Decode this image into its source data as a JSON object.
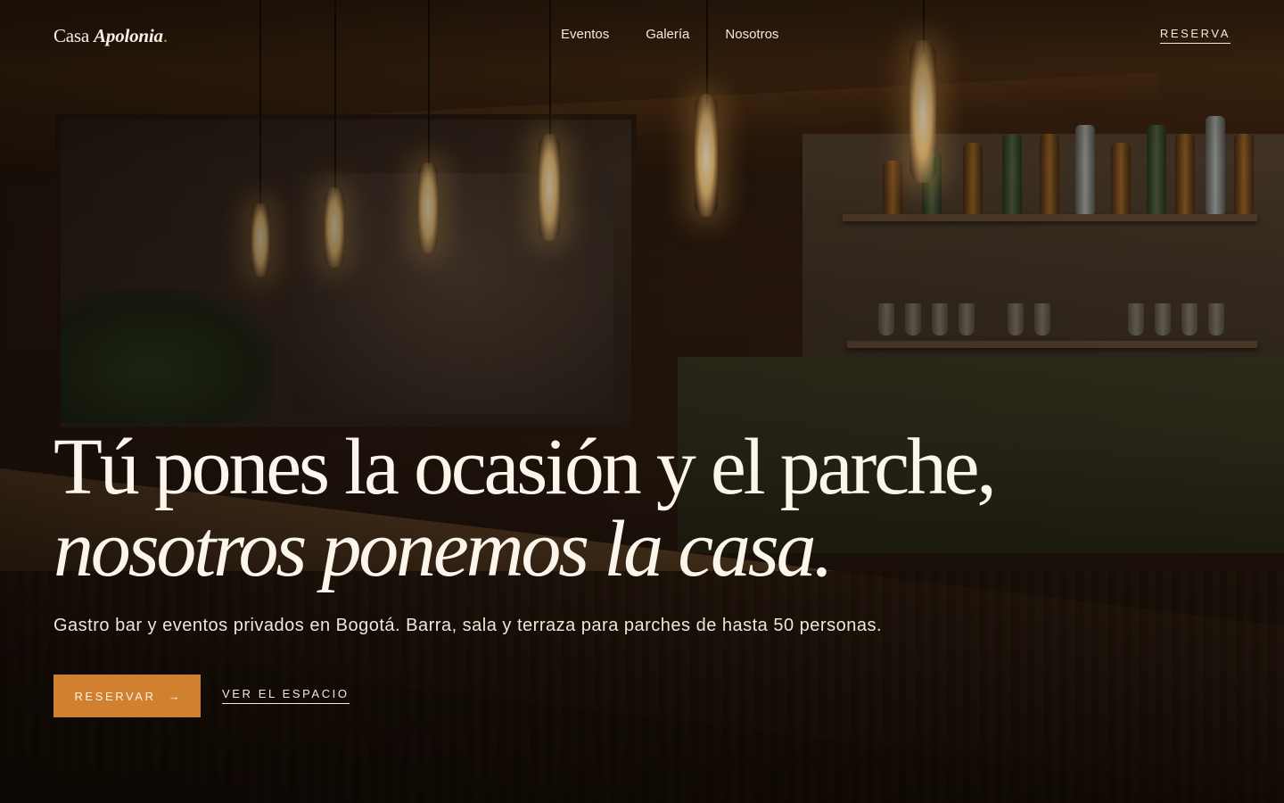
{
  "header": {
    "logo": {
      "prefix": "Casa",
      "brand": "Apolonia",
      "dot": "."
    },
    "nav": [
      {
        "label": "Eventos"
      },
      {
        "label": "Galería"
      },
      {
        "label": "Nosotros"
      }
    ],
    "reserve_label": "RESERVA"
  },
  "hero": {
    "headline_line1": "Tú pones la ocasión y el parche,",
    "headline_line2": "nosotros ponemos la casa.",
    "subtitle": "Gastro bar y eventos privados en Bogotá. Barra, sala y terraza para parches de hasta 50 personas.",
    "primary_cta": {
      "label": "RESERVAR",
      "arrow": "→"
    },
    "secondary_cta": {
      "label": "VER EL ESPACIO"
    }
  },
  "colors": {
    "accent": "#d0802f",
    "text": "#f5ede2",
    "background": "#0f0905"
  }
}
